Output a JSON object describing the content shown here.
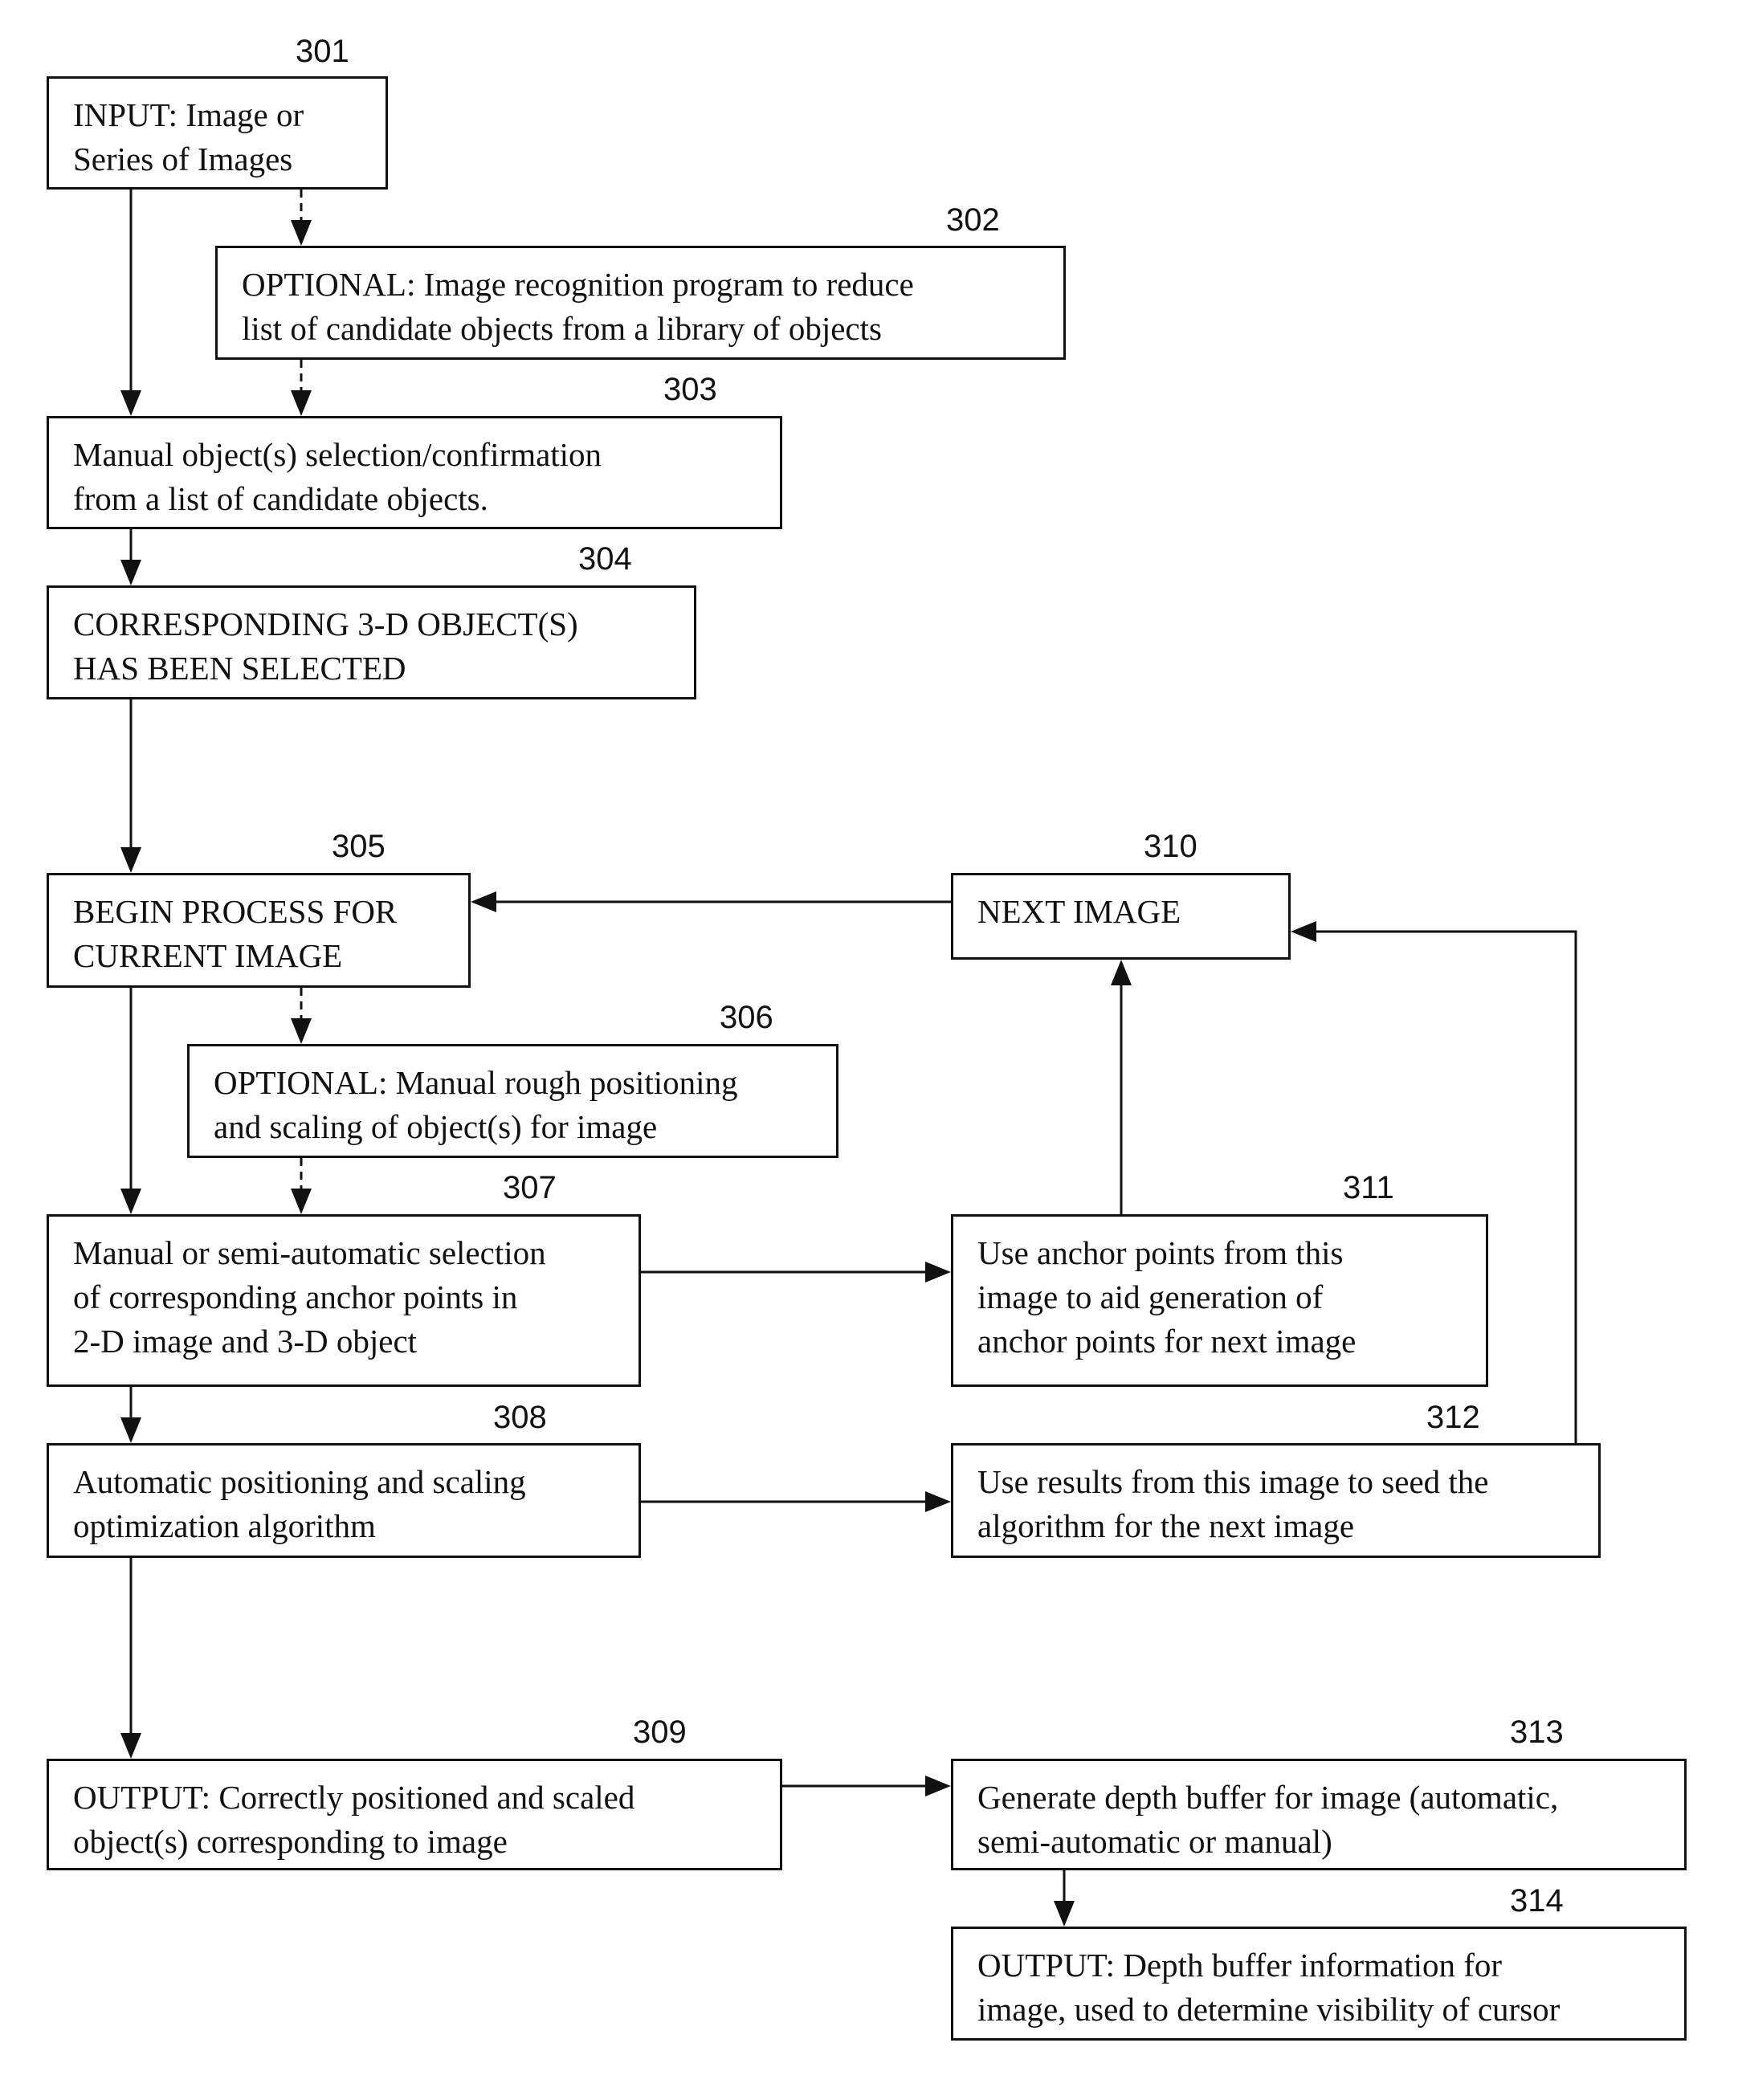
{
  "diagram": {
    "type": "flowchart",
    "nodes": [
      {
        "id": "301",
        "ref": "301",
        "text": "INPUT: Image or\nSeries of Images"
      },
      {
        "id": "302",
        "ref": "302",
        "text": "OPTIONAL: Image recognition program to reduce\nlist of candidate objects from a library of objects"
      },
      {
        "id": "303",
        "ref": "303",
        "text": "Manual object(s) selection/confirmation\nfrom a list of candidate objects."
      },
      {
        "id": "304",
        "ref": "304",
        "text": "CORRESPONDING 3-D OBJECT(S)\nHAS BEEN SELECTED"
      },
      {
        "id": "305",
        "ref": "305",
        "text": "BEGIN PROCESS FOR\nCURRENT IMAGE"
      },
      {
        "id": "306",
        "ref": "306",
        "text": "OPTIONAL: Manual rough positioning\nand scaling of object(s) for image"
      },
      {
        "id": "307",
        "ref": "307",
        "text": "Manual or semi-automatic selection\nof corresponding anchor points in\n2-D image and 3-D object"
      },
      {
        "id": "308",
        "ref": "308",
        "text": "Automatic positioning and scaling\noptimization algorithm"
      },
      {
        "id": "309",
        "ref": "309",
        "text": "OUTPUT: Correctly positioned and scaled\nobject(s) corresponding to image"
      },
      {
        "id": "310",
        "ref": "310",
        "text": "NEXT IMAGE"
      },
      {
        "id": "311",
        "ref": "311",
        "text": "Use anchor points from this\nimage to aid generation of\nanchor points for next image"
      },
      {
        "id": "312",
        "ref": "312",
        "text": "Use results from this image to seed the\nalgorithm for the next image"
      },
      {
        "id": "313",
        "ref": "313",
        "text": "Generate depth buffer for image (automatic,\nsemi-automatic or manual)"
      },
      {
        "id": "314",
        "ref": "314",
        "text": "OUTPUT: Depth buffer information for\nimage, used to determine visibility of cursor"
      }
    ],
    "edges": [
      {
        "from": "301",
        "to": "303",
        "style": "solid"
      },
      {
        "from": "301",
        "to": "302",
        "style": "dashed"
      },
      {
        "from": "302",
        "to": "303",
        "style": "dashed"
      },
      {
        "from": "303",
        "to": "304",
        "style": "solid"
      },
      {
        "from": "304",
        "to": "305",
        "style": "solid"
      },
      {
        "from": "305",
        "to": "307",
        "style": "solid"
      },
      {
        "from": "305",
        "to": "306",
        "style": "dashed"
      },
      {
        "from": "306",
        "to": "307",
        "style": "dashed"
      },
      {
        "from": "307",
        "to": "308",
        "style": "solid"
      },
      {
        "from": "307",
        "to": "311",
        "style": "solid"
      },
      {
        "from": "308",
        "to": "312",
        "style": "solid"
      },
      {
        "from": "308",
        "to": "309",
        "style": "solid"
      },
      {
        "from": "311",
        "to": "310",
        "style": "solid"
      },
      {
        "from": "312",
        "to": "310",
        "style": "solid"
      },
      {
        "from": "310",
        "to": "305",
        "style": "solid"
      },
      {
        "from": "309",
        "to": "313",
        "style": "solid"
      },
      {
        "from": "313",
        "to": "314",
        "style": "solid"
      }
    ]
  }
}
